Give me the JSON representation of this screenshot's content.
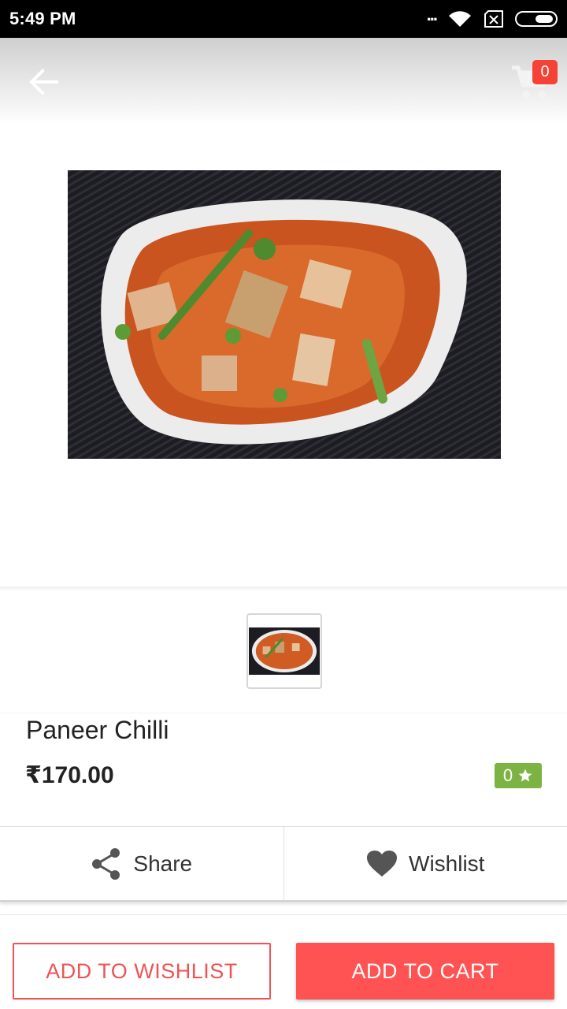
{
  "status_bar": {
    "time": "5:49 PM",
    "dots": "...",
    "icons": [
      "wifi-icon",
      "no-sim-icon",
      "battery-icon"
    ]
  },
  "header": {
    "back_icon": "arrow-left-icon",
    "cart_icon": "shopping-cart-icon",
    "cart_count": "0"
  },
  "product": {
    "name": "Paneer Chilli",
    "price": "₹170.00",
    "rating": "0",
    "rating_icon": "star-icon"
  },
  "actions": {
    "share_label": "Share",
    "wishlist_label": "Wishlist"
  },
  "buttons": {
    "add_to_wishlist": "ADD TO WISHLIST",
    "add_to_cart": "ADD TO CART"
  },
  "colors": {
    "accent": "#ff5252",
    "badge": "#f44336",
    "rating": "#7cb342"
  }
}
